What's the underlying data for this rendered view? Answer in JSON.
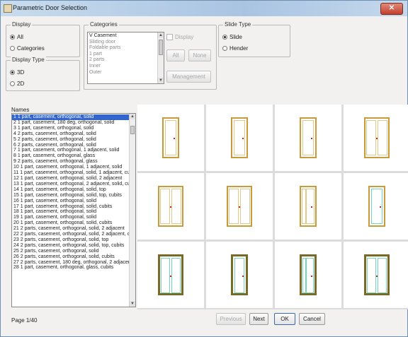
{
  "window": {
    "title": "Parametric Door Selection",
    "close_glyph": "✕"
  },
  "display": {
    "label": "Display",
    "options": [
      "All",
      "Categories"
    ],
    "selected": 0
  },
  "display_type": {
    "label": "Display Type",
    "options": [
      "3D",
      "2D"
    ],
    "selected": 0
  },
  "categories": {
    "label": "Categories",
    "items": [
      {
        "text": "V  Casement",
        "gray": false
      },
      {
        "text": "Sliding door",
        "gray": true
      },
      {
        "text": "Foldable parts",
        "gray": true
      },
      {
        "text": "1 part",
        "gray": true
      },
      {
        "text": "2 parts",
        "gray": true
      },
      {
        "text": "Inner",
        "gray": true
      },
      {
        "text": "Outer",
        "gray": true
      }
    ],
    "display_check": "Display",
    "all_button": "All",
    "none_button": "None",
    "management_button": "Management"
  },
  "slide_type": {
    "label": "Slide Type",
    "options": [
      "Slide",
      "Hender"
    ],
    "selected": 0
  },
  "names": {
    "label": "Names",
    "items": [
      "1 1 part, casement, orthogonal, solid",
      "2 1 part, casement, 180 deg, orthogonal, solid",
      "3 1 part, casement, orthogonal, solid",
      "4 2 parts, casement, orthogonal, solid",
      "5 2 parts, casement, orthogonal, solid",
      "6 2 parts, casement, orthogonal, solid",
      "7 1 part, casement, orthogonal, 1 adjacent, solid",
      "8 1 part, casement, orthogonal, glass",
      "9 2 parts, casement, orthogonal, glass",
      "10 1 part, casement, orthogonal, 1 adjacent, solid",
      "11 1 part, casement, orthogonal, solid, 1 adjacent, cubits",
      "12 1 part, casement, orthogonal, solid, 2 adjacent",
      "13 1 part, casement, orthogonal, 2 adjacent, solid, cubits",
      "14 1 part, casement, orthogonal, solid, top",
      "15 1 part, casement, orthogonal, solid, top, cubits",
      "16 1 part, casement, orthogonal, solid",
      "17 1 part, casement, orthogonal, solid, cubits",
      "18 1 part, casement, orthogonal, solid",
      "19 1 part, casement, orthogonal, solid",
      "20 1 part, casement, orthogonal, solid, cubits",
      "21 2 parts, casement, orthogonal, solid, 2 adjacent",
      "22 2 parts, casement, orthogonal, solid, 2 adjacent, cubits",
      "23 2 parts, casement, orthogonal, solid, top",
      "24 2 parts, casement, orthogonal, solid, top, cubits",
      "25 2 parts, casement, orthogonal, solid",
      "26 2 parts, casement, orthogonal, solid, cubits",
      "27 2 parts, casement, 180 deg, orthogonal, 2 adjacent",
      "28 1 part, casement, orthogonal, glass, cubits"
    ],
    "selected": 0
  },
  "status": {
    "page": "Page 1/40"
  },
  "buttons": {
    "previous": "Previous",
    "next": "Next",
    "ok": "OK",
    "cancel": "Cancel"
  },
  "colors": {
    "door_frame": "#c99a3a",
    "door_frame_dark": "#7a6a28",
    "glass": "#6ed8b8",
    "handle": "#d02020",
    "selection": "#3366cc"
  },
  "thumbnails": [
    {
      "type": "single-door",
      "style": "plain"
    },
    {
      "type": "single-door",
      "style": "plain"
    },
    {
      "type": "single-door",
      "style": "plain"
    },
    {
      "type": "double-door",
      "style": "plain"
    },
    {
      "type": "double-door",
      "style": "plain"
    },
    {
      "type": "double-door",
      "style": "plain"
    },
    {
      "type": "single-door",
      "style": "side-panel"
    },
    {
      "type": "single-door",
      "style": "glass"
    },
    {
      "type": "double-door",
      "style": "glass-dark"
    },
    {
      "type": "single-door",
      "style": "glass-dark"
    },
    {
      "type": "single-door",
      "style": "glass-side-dark"
    },
    {
      "type": "double-door",
      "style": "glass-dark-wide"
    }
  ]
}
